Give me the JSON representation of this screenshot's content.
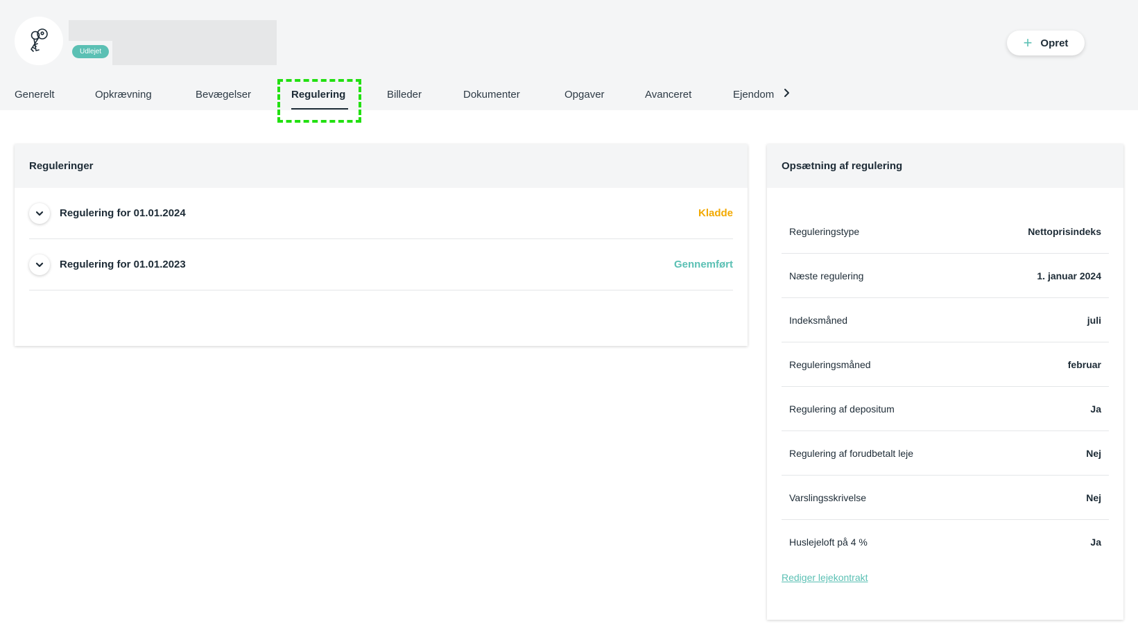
{
  "header": {
    "avatar_icon": "keys-icon",
    "status_badge": "Udlejet",
    "create_button": {
      "icon": "plus-icon",
      "label": "Opret"
    }
  },
  "tabs": [
    {
      "label": "Generelt"
    },
    {
      "label": "Opkrævning"
    },
    {
      "label": "Bevægelser"
    },
    {
      "label": "Regulering",
      "active": true
    },
    {
      "label": "Billeder"
    },
    {
      "label": "Dokumenter"
    },
    {
      "label": "Opgaver"
    },
    {
      "label": "Avanceret"
    },
    {
      "label": "Ejendom"
    }
  ],
  "regulations": {
    "title": "Reguleringer",
    "items": [
      {
        "title": "Regulering for 01.01.2024",
        "status": "Kladde",
        "status_color": "#f2a900"
      },
      {
        "title": "Regulering for 01.01.2023",
        "status": "Gennemført",
        "status_color": "#5bc0b4"
      }
    ]
  },
  "setup": {
    "title": "Opsætning af regulering",
    "rows": [
      {
        "label": "Reguleringstype",
        "value": "Nettoprisindeks"
      },
      {
        "label": "Næste regulering",
        "value": "1. januar 2024"
      },
      {
        "label": "Indeksmåned",
        "value": "juli"
      },
      {
        "label": "Reguleringsmåned",
        "value": "februar"
      },
      {
        "label": "Regulering af depositum",
        "value": "Ja"
      },
      {
        "label": "Regulering af forudbetalt leje",
        "value": "Nej"
      },
      {
        "label": "Varslingsskrivelse",
        "value": "Nej"
      },
      {
        "label": "Huslejeloft på 4 %",
        "value": "Ja"
      }
    ],
    "edit_link": "Rediger lejekontrakt"
  },
  "colors": {
    "accent": "#5bc0b4",
    "draft": "#f2a900",
    "text": "#1d2b36",
    "highlight": "#22e011"
  }
}
